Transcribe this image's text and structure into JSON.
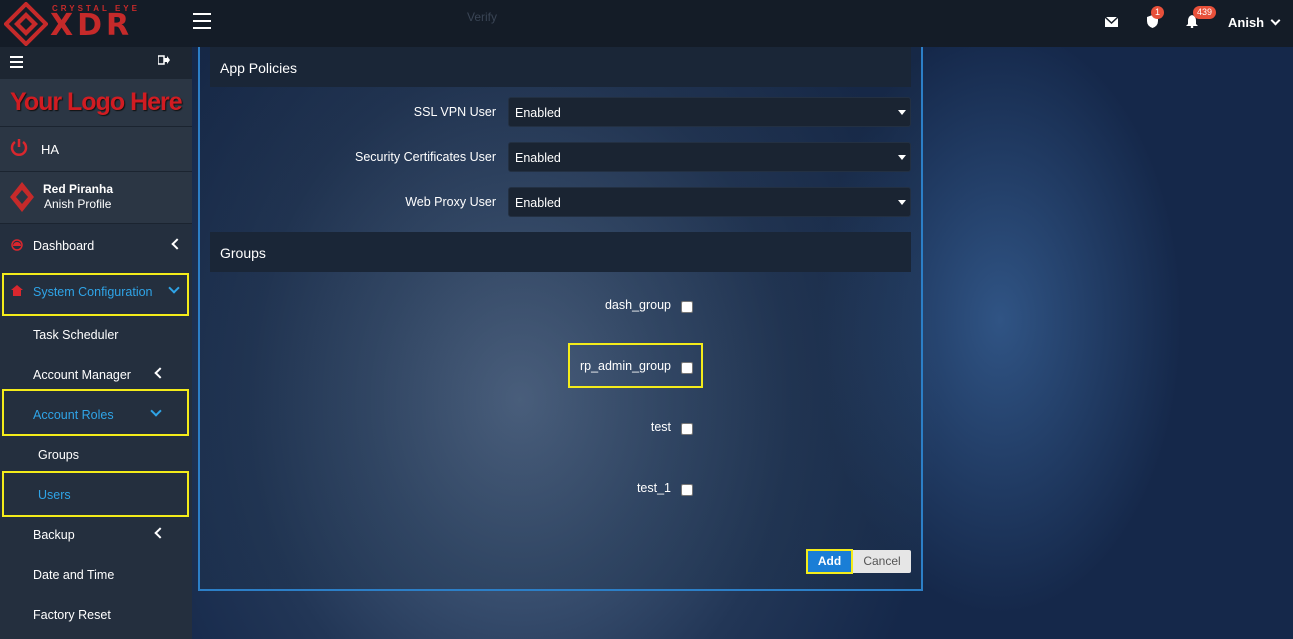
{
  "header": {
    "brand_top": "CRYSTAL EYE",
    "brand_main": "XDR",
    "ghost_text": "Verify",
    "shield_badge": "1",
    "bell_badge": "439",
    "user_name": "Anish"
  },
  "sidebar": {
    "logo_text": "Your Logo Here",
    "ha_label": "HA",
    "profile_company": "Red Piranha",
    "profile_name": "Anish Profile",
    "items": [
      {
        "label": "Dashboard"
      },
      {
        "label": "System Configuration"
      },
      {
        "label": "Task Scheduler"
      },
      {
        "label": "Account Manager"
      },
      {
        "label": "Account Roles"
      },
      {
        "label": "Groups"
      },
      {
        "label": "Users"
      },
      {
        "label": "Backup"
      },
      {
        "label": "Date and Time"
      },
      {
        "label": "Factory Reset"
      }
    ]
  },
  "form": {
    "app_policies_title": "App Policies",
    "policies": [
      {
        "label": "SSL VPN User",
        "value": "Enabled"
      },
      {
        "label": "Security Certificates User",
        "value": "Enabled"
      },
      {
        "label": "Web Proxy User",
        "value": "Enabled"
      }
    ],
    "groups_title": "Groups",
    "groups": [
      {
        "label": "dash_group",
        "checked": false
      },
      {
        "label": "rp_admin_group",
        "checked": false
      },
      {
        "label": "test",
        "checked": false
      },
      {
        "label": "test_1",
        "checked": false
      }
    ],
    "add_label": "Add",
    "cancel_label": "Cancel"
  },
  "colors": {
    "accent": "#2fa4e7",
    "brand_red": "#c62a2a",
    "highlight": "#f4ec1a",
    "primary_button": "#1a7ed6"
  },
  "icons": [
    "menu-icon",
    "envelope-icon",
    "shield-icon",
    "bell-icon",
    "chevron-down-icon",
    "logout-icon",
    "power-icon",
    "dashboard-icon",
    "home-icon"
  ]
}
